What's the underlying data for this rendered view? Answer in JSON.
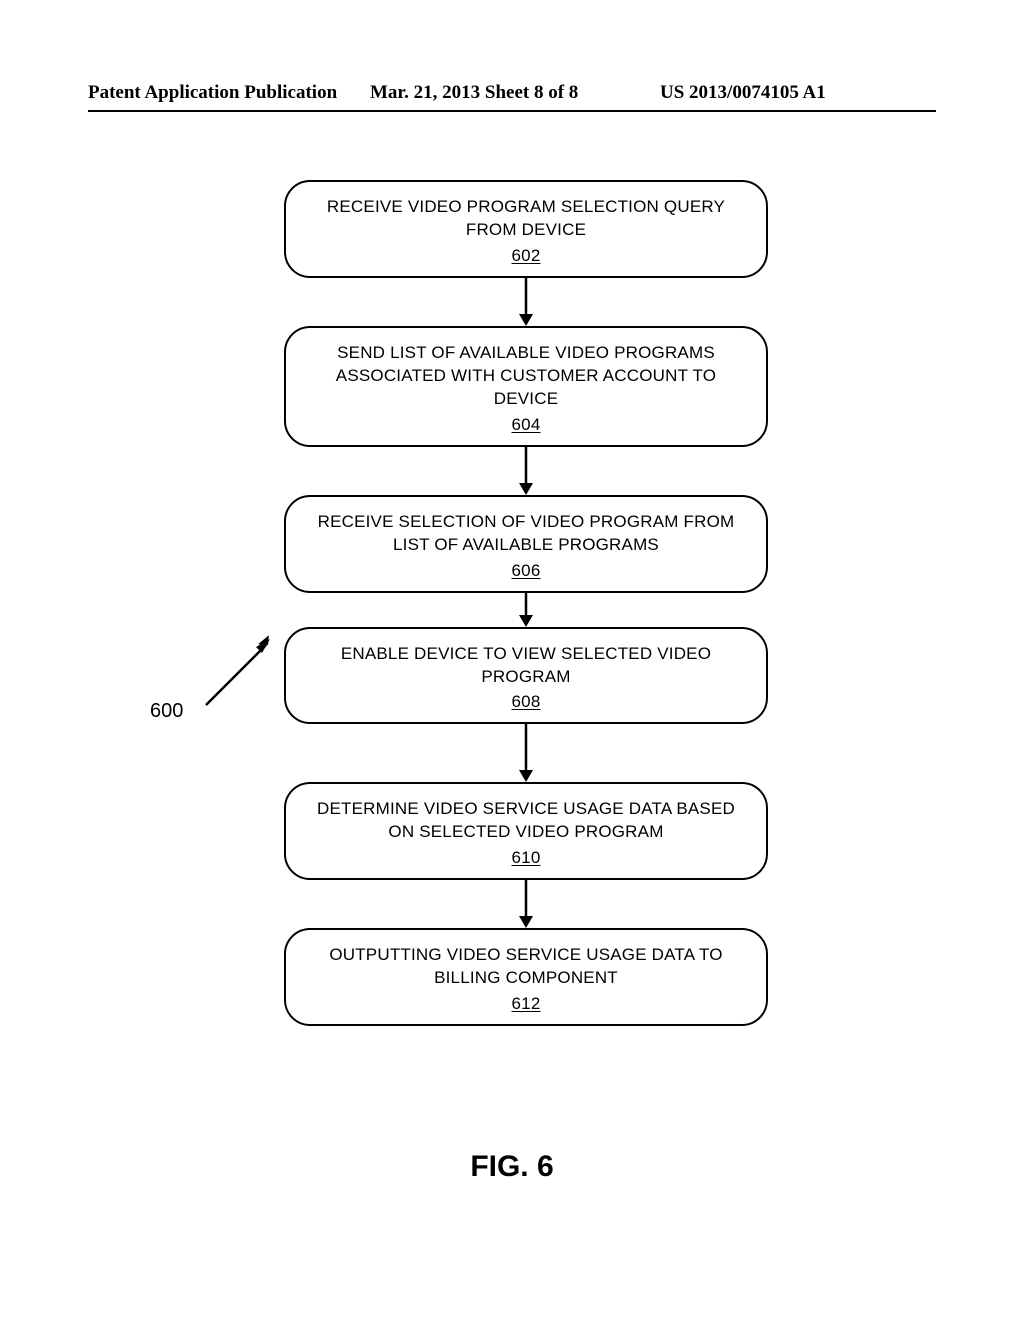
{
  "header": {
    "left": "Patent Application Publication",
    "center": "Mar. 21, 2013  Sheet 8 of 8",
    "right": "US 2013/0074105 A1"
  },
  "diagram": {
    "ref_label": "600",
    "caption": "FIG. 6",
    "steps": [
      {
        "text": "RECEIVE VIDEO PROGRAM SELECTION QUERY FROM DEVICE",
        "ref": "602"
      },
      {
        "text": "SEND LIST OF AVAILABLE VIDEO PROGRAMS ASSOCIATED WITH CUSTOMER ACCOUNT TO DEVICE",
        "ref": "604"
      },
      {
        "text": "RECEIVE SELECTION OF VIDEO PROGRAM FROM LIST OF AVAILABLE PROGRAMS",
        "ref": "606"
      },
      {
        "text": "ENABLE DEVICE TO VIEW SELECTED VIDEO PROGRAM",
        "ref": "608"
      },
      {
        "text": "DETERMINE VIDEO SERVICE USAGE DATA BASED ON SELECTED VIDEO PROGRAM",
        "ref": "610"
      },
      {
        "text": "OUTPUTTING VIDEO SERVICE USAGE DATA TO BILLING COMPONENT",
        "ref": "612"
      }
    ]
  }
}
